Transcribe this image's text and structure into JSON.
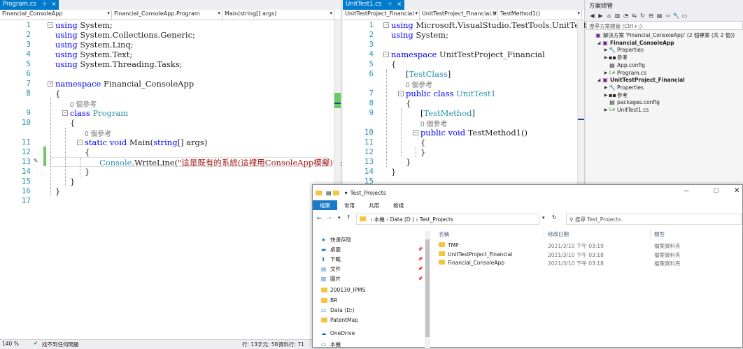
{
  "left_editor": {
    "tab": {
      "name": "Program.cs",
      "pin": "⊹",
      "close": "×"
    },
    "nav": [
      "Financial_ConsoleApp",
      "Financial_ConsoleApp.Program",
      "Main(string[] args)"
    ],
    "line_numbers": [
      "1",
      "2",
      "3",
      "4",
      "5",
      "6",
      "7",
      "8",
      "9",
      "10",
      "11",
      "12",
      "13",
      "14",
      "15",
      "16",
      "17"
    ],
    "code": {
      "l1": [
        "using",
        " System;"
      ],
      "l2": [
        "using",
        " System.Collections.Generic;"
      ],
      "l3": [
        "using",
        " System.Linq;"
      ],
      "l4": [
        "using",
        " System.Text;"
      ],
      "l5": [
        "using",
        " System.Threading.Tasks;"
      ],
      "l7": [
        "namespace",
        " Financial_ConsoleApp"
      ],
      "l8": "{",
      "ref_program": "0 個參考",
      "l9": [
        "class",
        " ",
        "Program"
      ],
      "l10": "{",
      "ref_main": "0 個參考",
      "l11": [
        "static",
        " ",
        "void",
        " Main(",
        "string",
        "[] args)"
      ],
      "l12": "{",
      "l13": [
        "Console",
        ".WriteLine(",
        "\"這是既有的系統(這裡用ConsoleApp模擬)\"",
        ");"
      ],
      "l14": "}",
      "l15": "}",
      "l16": "}"
    },
    "status": {
      "zoom": "140 %",
      "issues": "找不到任何問題",
      "ln": "行: 13",
      "ch": "字元: 58",
      "col": "資料行: 71"
    }
  },
  "right_editor": {
    "tab": {
      "name": "UnitTest1.cs",
      "pin": "⊹",
      "close": "×"
    },
    "nav": [
      "UnitTestProject_Financial",
      "UnitTestProject_Financial.U",
      "TestMethod1()"
    ],
    "line_numbers": [
      "1",
      "2",
      "3",
      "4",
      "5",
      "6",
      "7",
      "8",
      "9",
      "10",
      "11",
      "12",
      "13",
      "14",
      "15"
    ],
    "code": {
      "l1": [
        "using",
        " Microsoft.VisualStudio.TestTools.UnitTesti"
      ],
      "l2": [
        "using",
        " System;"
      ],
      "l4": [
        "namespace",
        " UnitTestProject_Financial"
      ],
      "l5": "{",
      "l6": [
        "[",
        "TestClass",
        "]"
      ],
      "ref_class": "0 個參考",
      "l7": [
        "public",
        " ",
        "class",
        " ",
        "UnitTest1"
      ],
      "l8": "{",
      "l9": [
        "[",
        "TestMethod",
        "]"
      ],
      "ref_method": "0 個參考",
      "l10": [
        "public",
        " ",
        "void",
        " TestMethod1()"
      ],
      "l11": "{",
      "l12": "}",
      "l13": "}",
      "l14": "}"
    }
  },
  "solution_explorer": {
    "title": "方案總管",
    "search_placeholder": "搜尋方案總管 (Ctrl+;)",
    "tree": [
      {
        "label": "解決方案 'Financial_ConsoleApp' (2 個專案 (共 2 個))",
        "indent": 0,
        "icon": "solution-icon",
        "glyph": "▣",
        "tri": ""
      },
      {
        "label": "Financial_ConsoleApp",
        "indent": 1,
        "icon": "csproj-icon",
        "glyph": "▣",
        "tri": "◢",
        "bold": true
      },
      {
        "label": "Properties",
        "indent": 2,
        "icon": "wrench-icon",
        "glyph": "🔧",
        "tri": "▶"
      },
      {
        "label": "參考",
        "indent": 2,
        "icon": "references-icon",
        "glyph": "▪▪",
        "tri": "▶"
      },
      {
        "label": "App.config",
        "indent": 2,
        "icon": "config-icon",
        "glyph": "▤",
        "tri": ""
      },
      {
        "label": "Program.cs",
        "indent": 2,
        "icon": "csharp-file-icon",
        "glyph": "C#",
        "tri": "▶"
      },
      {
        "label": "UnitTestProject_Financial",
        "indent": 1,
        "icon": "test-project-icon",
        "glyph": "▣",
        "tri": "◢",
        "bold": true
      },
      {
        "label": "Properties",
        "indent": 2,
        "icon": "wrench-icon",
        "glyph": "🔧",
        "tri": "▶"
      },
      {
        "label": "參考",
        "indent": 2,
        "icon": "references-icon",
        "glyph": "▪▪",
        "tri": "▶"
      },
      {
        "label": "packages.config",
        "indent": 2,
        "icon": "config-icon",
        "glyph": "▤",
        "tri": ""
      },
      {
        "label": "UnitTest1.cs",
        "indent": 2,
        "icon": "csharp-file-icon",
        "glyph": "C#",
        "tri": "▶"
      }
    ]
  },
  "file_explorer": {
    "title": "Test_Projects",
    "ribbon_tabs": [
      "檔案",
      "常用",
      "共用",
      "檢視"
    ],
    "address_parts": [
      "本機",
      "Data (D:)",
      "Test_Projects"
    ],
    "search_placeholder": "搜尋 Test_Projects",
    "columns": [
      "名稱",
      "修改日期",
      "類型"
    ],
    "nav_items": [
      {
        "label": "快速存取",
        "icon": "star-icon",
        "glyph": "★",
        "pinned": false
      },
      {
        "label": "桌面",
        "icon": "desktop-icon",
        "glyph": "▬",
        "pinned": true
      },
      {
        "label": "下載",
        "icon": "download-icon",
        "glyph": "⬇",
        "pinned": true
      },
      {
        "label": "文件",
        "icon": "document-icon",
        "glyph": "▤",
        "pinned": true
      },
      {
        "label": "圖片",
        "icon": "picture-icon",
        "glyph": "▨",
        "pinned": true
      },
      {
        "label": "200130_IPMS",
        "icon": "folder-icon",
        "glyph": "",
        "pinned": false
      },
      {
        "label": "BR",
        "icon": "folder-icon",
        "glyph": "",
        "pinned": false
      },
      {
        "label": "Data (D:)",
        "icon": "drive-icon",
        "glyph": "▭",
        "pinned": false
      },
      {
        "label": "PatentMap",
        "icon": "folder-icon",
        "glyph": "",
        "pinned": false
      },
      {
        "label": "OneDrive",
        "icon": "onedrive-icon",
        "glyph": "☁",
        "pinned": false
      },
      {
        "label": "本機",
        "icon": "computer-icon",
        "glyph": "▭",
        "pinned": false
      }
    ],
    "files": [
      {
        "name": "TMP",
        "date": "2021/3/10 下午 03:19",
        "type": "檔案資料夾"
      },
      {
        "name": "UnitTestProject_Financial",
        "date": "2021/3/10 下午 03:18",
        "type": "檔案資料夾"
      },
      {
        "name": "Financial_ConsoleApp",
        "date": "2021/3/10 下午 03:18",
        "type": "檔案資料夾"
      }
    ]
  },
  "colors": {
    "accent": "#007acc",
    "keyword": "#0000ff",
    "type": "#2b91af",
    "string": "#a31515",
    "folder": "#f5c542"
  }
}
